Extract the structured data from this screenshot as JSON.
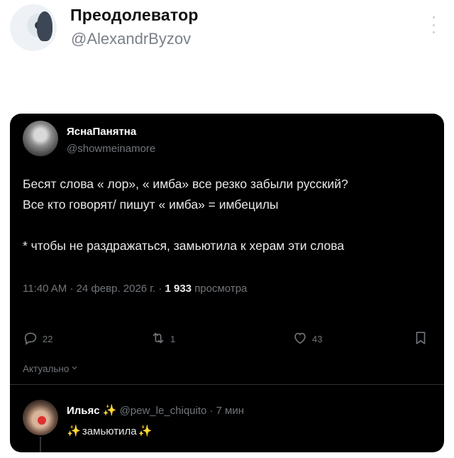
{
  "outer": {
    "display_name": "Преодолеватор",
    "handle": "@AlexandrByzov"
  },
  "quoted": {
    "display_name": "ЯснаПанятна",
    "handle": "@showmeinamore",
    "text": "Бесят слова « лор», « имба» все резко забыли русский?\nВсе кто говорят/ пишут « имба» = имбецилы\n\n* чтобы не раздражаться, замьютила к херам эти слова",
    "time": "11:40 AM · 24 февр. 2026 г. ·",
    "views_count": "1 933",
    "views_label": "просмотра"
  },
  "actions": {
    "replies": "22",
    "retweets": "1",
    "likes": "43"
  },
  "sort_label": "Актуально",
  "reply": {
    "display_name": "Ильяс",
    "name_emoji": "✨",
    "handle": "@pew_le_chiquito",
    "time": "· 7 мин",
    "text_emoji": "✨",
    "text": "замьютила"
  },
  "colors": {
    "card_bg": "#000000",
    "muted": "#71767b",
    "text_light": "#e7e9ea",
    "sparkle": "#f6c744"
  },
  "icons": [
    "more-vertical-icon",
    "reply-icon",
    "retweet-icon",
    "like-icon",
    "bookmark-icon",
    "chevron-down-icon",
    "sparkle-icon"
  ]
}
